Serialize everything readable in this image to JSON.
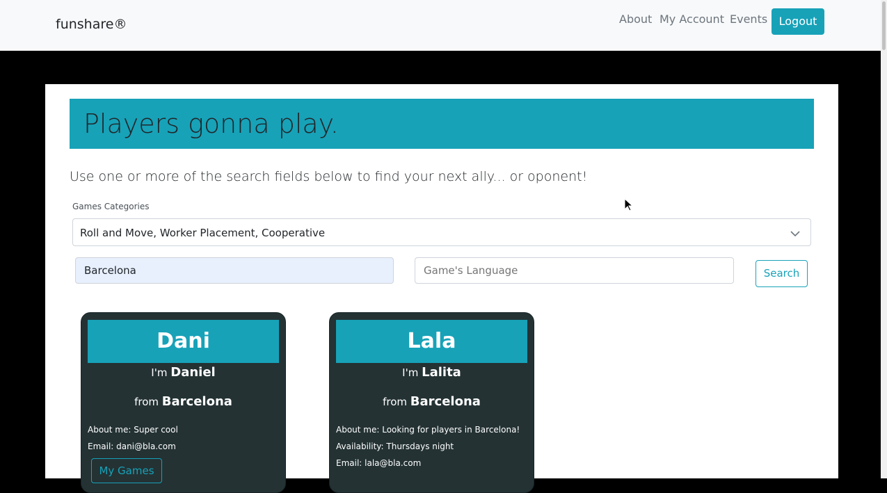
{
  "navbar": {
    "brand": "funshare®",
    "links": [
      "About",
      "My Account",
      "Events"
    ],
    "logout_label": "Logout"
  },
  "jumbotron": {
    "title": "Players gonna play."
  },
  "intro": "Use one or more of the search fields below to find your next ally... or oponent!",
  "search": {
    "categories_label": "Games Categories",
    "categories_value": "Roll and Move, Worker Placement, Cooperative",
    "city_value": "Barcelona",
    "language_placeholder": "Game's Language",
    "search_label": "Search"
  },
  "players": [
    {
      "nickname": "Dani",
      "im_prefix": "I'm",
      "name": "Daniel",
      "from_prefix": "from",
      "city": "Barcelona",
      "about": "About me: Super cool",
      "email": "Email: dani@bla.com",
      "games_label": "My Games"
    },
    {
      "nickname": "Lala",
      "im_prefix": "I'm",
      "name": "Lalita",
      "from_prefix": "from",
      "city": "Barcelona",
      "about": "About me: Looking for players in Barcelona!",
      "availability": "Availability: Thursdays night",
      "email": "Email: lala@bla.com"
    }
  ],
  "colors": {
    "accent": "#17a2b8",
    "card_bg": "#243234",
    "navbar_bg": "#f8f9fa"
  }
}
